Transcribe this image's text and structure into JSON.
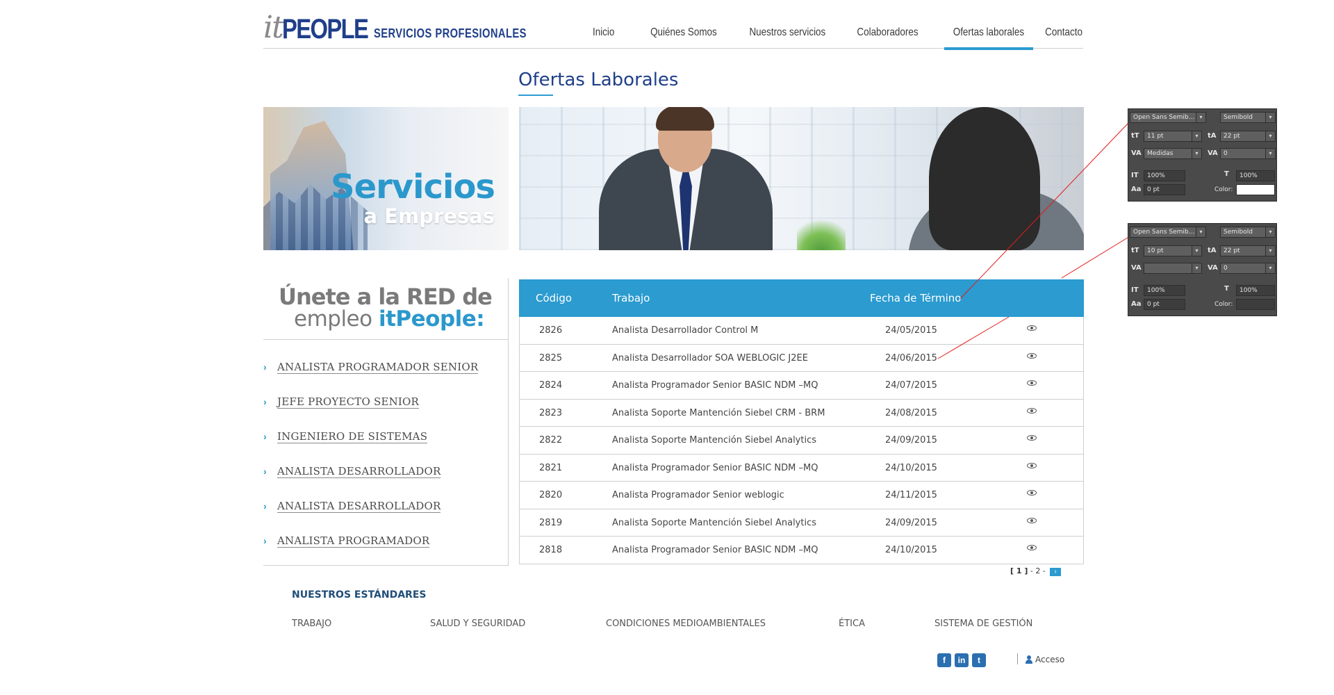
{
  "brand": {
    "it": "it",
    "people": "PEOPLE",
    "tagline": "SERVICIOS PROFESIONALES"
  },
  "nav": [
    {
      "label": "Inicio",
      "active": false
    },
    {
      "label": "Quiénes Somos",
      "active": false
    },
    {
      "label": "Nuestros servicios",
      "active": false
    },
    {
      "label": "Colaboradores",
      "active": false
    },
    {
      "label": "Ofertas laborales",
      "active": true
    },
    {
      "label": "Contacto",
      "active": false
    }
  ],
  "page_title": "Ofertas Laborales",
  "banner_left": {
    "title": "Servicios",
    "subtitle": "a Empresas"
  },
  "sidebar": {
    "join_line1": "Únete a la RED de",
    "join_line2_prefix": "empleo ",
    "join_line2_brand": "itPeople:",
    "links": [
      "ANALISTA PROGRAMADOR SENIOR",
      "JEFE PROYECTO SENIOR",
      "INGENIERO DE SISTEMAS",
      "ANALISTA DESARROLLADOR",
      "ANALISTA DESARROLLADOR",
      "ANALISTA PROGRAMADOR"
    ]
  },
  "table": {
    "headers": {
      "code": "Código",
      "job": "Trabajo",
      "date": "Fecha de Término"
    },
    "rows": [
      {
        "code": "2826",
        "job": "Analista Desarrollador Control M",
        "date": "24/05/2015"
      },
      {
        "code": "2825",
        "job": "Analista Desarrollador SOA WEBLOGIC J2EE",
        "date": "24/06/2015"
      },
      {
        "code": "2824",
        "job": "Analista Programador Senior BASIC NDM –MQ",
        "date": "24/07/2015"
      },
      {
        "code": "2823",
        "job": "Analista Soporte Mantención Siebel CRM - BRM",
        "date": "24/08/2015"
      },
      {
        "code": "2822",
        "job": "Analista Soporte Mantención Siebel Analytics",
        "date": "24/09/2015"
      },
      {
        "code": "2821",
        "job": "Analista Programador Senior BASIC NDM –MQ",
        "date": "24/10/2015"
      },
      {
        "code": "2820",
        "job": "Analista Programador Senior weblogic",
        "date": "24/11/2015"
      },
      {
        "code": "2819",
        "job": "Analista Soporte Mantención Siebel Analytics",
        "date": "24/09/2015"
      },
      {
        "code": "2818",
        "job": "Analista Programador Senior BASIC NDM –MQ",
        "date": "24/10/2015"
      }
    ]
  },
  "pager": {
    "current": "[ 1 ]",
    "sep": " - ",
    "page2": "2",
    "trail": " -",
    "next": "›"
  },
  "standards": {
    "title": "NUESTROS ESTÁNDARES",
    "items": [
      "TRABAJO",
      "SALUD Y SEGURIDAD",
      "CONDICIONES MEDIOAMBIENTALES",
      "ÉTICA",
      "SISTEMA DE GESTIÓN"
    ]
  },
  "footer": {
    "social": [
      "f",
      "in",
      "t"
    ],
    "login": "Acceso"
  },
  "ps_panel_1": {
    "font": "Open Sans Semib...",
    "weight": "Semibold",
    "size": "11 pt",
    "leading": "22 pt",
    "kerning": "Medidas",
    "tracking": "0",
    "vscale": "100%",
    "hscale": "100%",
    "baseline": "0 pt",
    "color_label": "Color:"
  },
  "ps_panel_2": {
    "font": "Open Sans Semib...",
    "weight": "Semibold",
    "size": "10 pt",
    "leading": "22 pt",
    "kerning": "",
    "tracking": "0",
    "vscale": "100%",
    "hscale": "100%",
    "baseline": "0 pt",
    "color_label": "Color:"
  },
  "colors": {
    "accent": "#2b9bd0",
    "brand": "#1f3f8a",
    "connector": "#e21b1b"
  }
}
